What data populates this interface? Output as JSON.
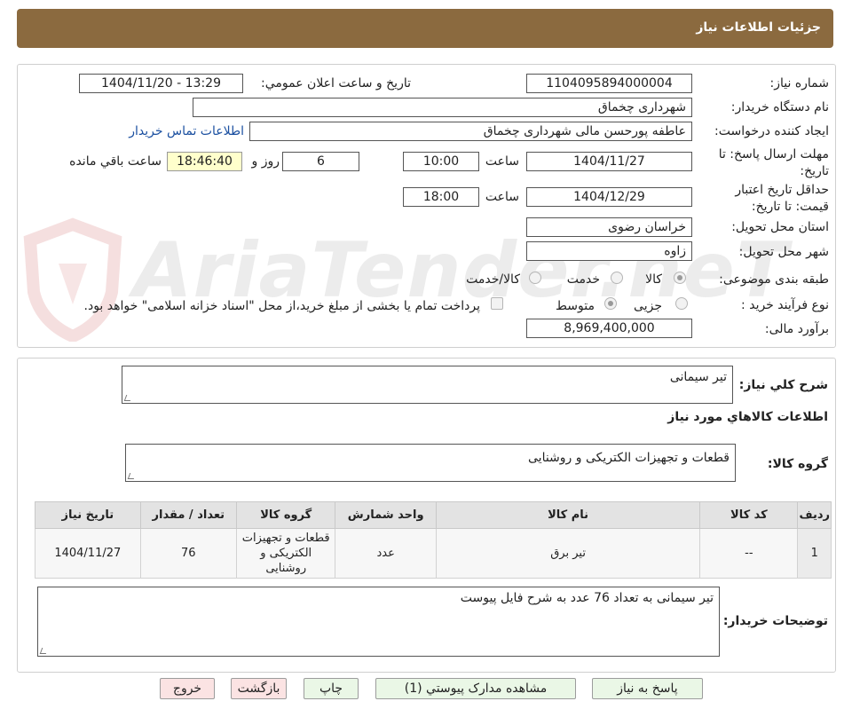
{
  "header": {
    "title": "جزئیات اطلاعات نیاز"
  },
  "form": {
    "need_number_label": "شماره نیاز:",
    "need_number": "1104095894000004",
    "announce_label": "تاریخ و ساعت اعلان عمومي:",
    "announce_value": "1404/11/20 - 13:29",
    "buyer_org_label": "نام دستگاه خريدار:",
    "buyer_org": "شهرداری چخماق",
    "creator_label": "ایجاد کننده درخواست:",
    "creator": "عاطفه پورحسن مالی شهرداری چخماق",
    "contact_link": "اطلاعات تماس خریدار",
    "deadline_label": "مهلت ارسال پاسخ: تا تاریخ:",
    "deadline_date": "1404/11/27",
    "time_label": "ساعت",
    "deadline_time": "10:00",
    "days": "6",
    "days_label": "روز و",
    "remaining_time": "18:46:40",
    "remaining_label": "ساعت باقي مانده",
    "validity_label": "حداقل تاریخ اعتبار قیمت: تا تاریخ:",
    "validity_date": "1404/12/29",
    "validity_time_label": "ساعت",
    "validity_time": "18:00",
    "province_label": "استان محل تحویل:",
    "province": "خراسان رضوی",
    "city_label": "شهر محل تحویل:",
    "city": "زاوه",
    "category_label": "طبقه بندی موضوعی:",
    "category_options": [
      "کالا",
      "خدمت",
      "کالا/خدمت"
    ],
    "category_selected": "کالا",
    "process_label": "نوع فرآیند خرید :",
    "process_options": [
      "جزیی",
      "متوسط"
    ],
    "process_selected": "متوسط",
    "payment_note": "پرداخت تمام یا بخشی از مبلغ خرید،از محل \"اسناد خزانه اسلامی\" خواهد بود.",
    "estimate_label": "برآورد مالی:",
    "estimate": "8,969,400,000"
  },
  "details": {
    "summary_label": "شرح کلي نياز:",
    "summary": "تیر سیمانی",
    "goods_section_title": "اطلاعات کالاهاي مورد نياز",
    "goods_group_label": "گروه کالا:",
    "goods_group": "قطعات و تجهیزات الکتریکی و روشنایی",
    "table": {
      "headers": [
        "رديف",
        "کد کالا",
        "نام کالا",
        "واحد شمارش",
        "گروه کالا",
        "تعداد / مقدار",
        "تاريخ نياز"
      ],
      "rows": [
        [
          "1",
          "--",
          "تیر برق",
          "عدد",
          "قطعات و تجهیزات الکتریکی و روشنایی",
          "76",
          "1404/11/27"
        ]
      ]
    },
    "buyer_notes_label": "توضيحات خريدار:",
    "buyer_notes": "تیر سیمانی به تعداد 76 عدد به شرح فایل پیوست"
  },
  "buttons": {
    "reply": "پاسخ به نياز",
    "attachments": "مشاهده مدارک پيوستي (1)",
    "print": "چاپ",
    "back": "بازگشت",
    "exit": "خروج"
  },
  "watermark": {
    "text": "AriaTender.neT"
  },
  "colors": {
    "header": "#8b6a3f",
    "link": "#1a4fa0",
    "green_button": "#eaf7e6",
    "red_button": "#fbe3e3"
  }
}
